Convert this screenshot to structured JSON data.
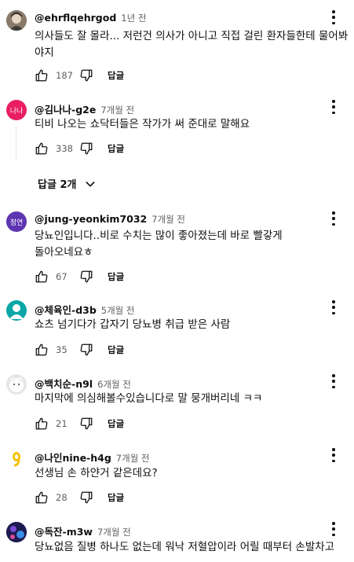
{
  "comments": [
    {
      "author": "@ehrflqehrgod",
      "time": "1년 전",
      "text": "의사들도 잘 몰라... 저런건 의사가 아니고 직접 걸린 환자들한테 물어봐야지",
      "likes": "187",
      "reply": "답글",
      "avatar_color": "#6b5a4b"
    },
    {
      "author": "@김나나-g2e",
      "time": "7개월 전",
      "text": "티비 나오는 쇼닥터들은 작가가 써 준대로 말해요",
      "likes": "338",
      "reply": "답글",
      "avatar_text": "나나",
      "avatar_color": "#e91e63"
    },
    {
      "author": "@jung-yeonkim7032",
      "time": "7개월 전",
      "text": "당뇨인입니다..비로 수치는 많이 좋아졌는데 바로 빨갛게 돌아오네요ㅎ",
      "likes": "67",
      "reply": "답글",
      "avatar_text": "정연",
      "avatar_color": "#5e35b1"
    },
    {
      "author": "@체육인-d3b",
      "time": "5개월 전",
      "text": "쇼츠 넘기다가 갑자기 당뇨병 취급 받은 사람",
      "likes": "35",
      "reply": "답글",
      "avatar_color": "#0aa6a6"
    },
    {
      "author": "@백치순-n9l",
      "time": "6개월 전",
      "text": "마지막에 의심해볼수있습니다로 말 뭉개버리네 ㅋㅋ",
      "likes": "21",
      "reply": "답글",
      "avatar_color": "#e6e6e6"
    },
    {
      "author": "@나인nine-h4g",
      "time": "7개월 전",
      "text": "선생님 손 하얀거 같은데요?",
      "likes": "28",
      "reply": "답글",
      "avatar_color": "#ffffff"
    },
    {
      "author": "@독잔-m3w",
      "time": "7개월 전",
      "text": "당뇨없음 질병 하나도 없는데 워낙 저혈압이라 어릴 때부터 손발차고",
      "avatar_color": "#2b2a6e"
    }
  ],
  "replies_toggle": {
    "label": "답글 2개"
  }
}
